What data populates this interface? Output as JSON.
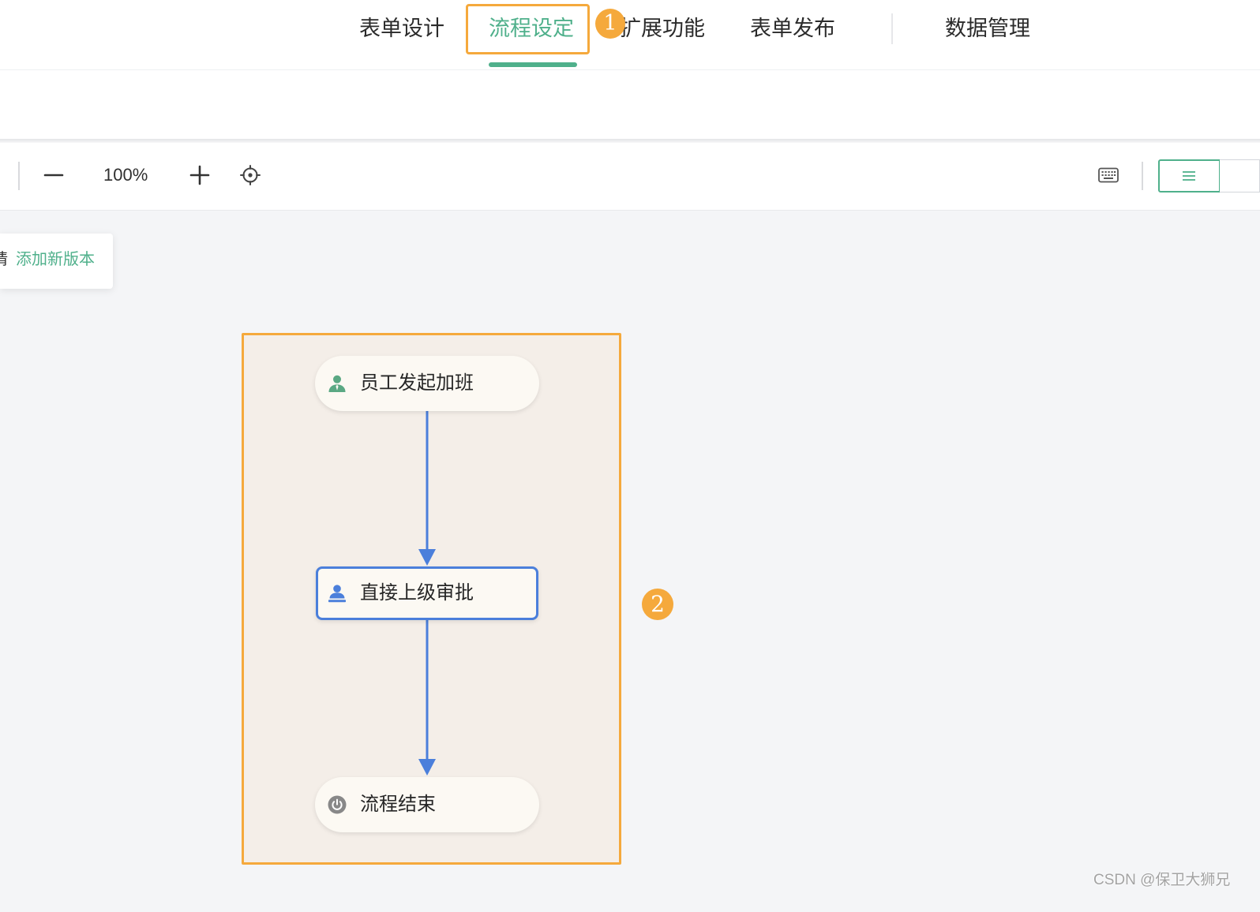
{
  "colors": {
    "accent": "#4fb08b",
    "annotation": "#f5a93c",
    "connector": "#4b7fdb",
    "canvas": "#f4f5f7"
  },
  "nav": {
    "tabs": [
      {
        "label": "表单设计",
        "active": false
      },
      {
        "label": "流程设定",
        "active": true
      },
      {
        "label": "扩展功能",
        "active": false
      },
      {
        "label": "表单发布",
        "active": false
      },
      {
        "label": "数据管理",
        "active": false
      }
    ]
  },
  "toolbar": {
    "zoom_out_icon": "minus-icon",
    "zoom_level": "100%",
    "zoom_in_icon": "plus-icon",
    "locate_icon": "locate-icon",
    "shortcuts_icon": "keyboard-icon",
    "view_toggle_icon": "menu-icon"
  },
  "version_notice": {
    "prefix": "请",
    "link": "添加新版本"
  },
  "flow": {
    "nodes": [
      {
        "label": "员工发起加班",
        "icon": "user-icon",
        "icon_color": "#5aa883",
        "selected": false
      },
      {
        "label": "直接上级审批",
        "icon": "approver-icon",
        "icon_color": "#4b7fdb",
        "selected": true
      },
      {
        "label": "流程结束",
        "icon": "power-icon",
        "icon_color": "#888888",
        "selected": false
      }
    ],
    "edges": [
      [
        0,
        1
      ],
      [
        1,
        2
      ]
    ]
  },
  "annotations": [
    {
      "marker": "1"
    },
    {
      "marker": "2"
    }
  ],
  "watermark": "CSDN @保卫大狮兄"
}
